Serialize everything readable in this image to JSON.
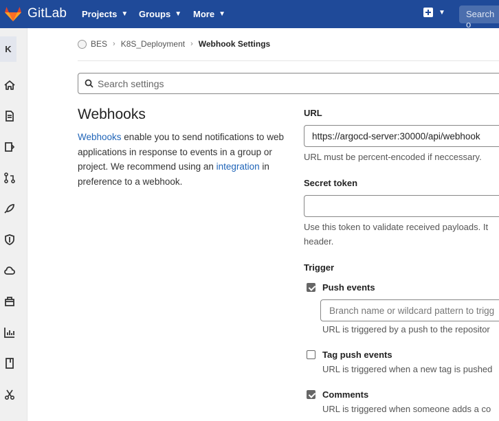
{
  "header": {
    "brand": "GitLab",
    "nav": [
      {
        "label": "Projects"
      },
      {
        "label": "Groups"
      },
      {
        "label": "More"
      }
    ],
    "search_placeholder": "Search o"
  },
  "sidebar": {
    "avatar_letter": "K",
    "icons": [
      "home-icon",
      "file-icon",
      "issues-icon",
      "merge-request-icon",
      "rocket-icon",
      "shield-icon",
      "cloud-icon",
      "package-icon",
      "analytics-icon",
      "book-icon",
      "scissors-icon"
    ]
  },
  "breadcrumb": {
    "items": [
      "BES",
      "K8S_Deployment",
      "Webhook Settings"
    ]
  },
  "settings_search": {
    "placeholder": "Search settings"
  },
  "intro": {
    "title": "Webhooks",
    "link1": "Webhooks",
    "text1": " enable you to send notifications to web applications in response to events in a group or project. We recommend using an ",
    "link2": "integration",
    "text2": " in preference to a webhook."
  },
  "form": {
    "url_label": "URL",
    "url_value": "https://argocd-server:30000/api/webhook",
    "url_help": "URL must be percent-encoded if neccessary.",
    "secret_label": "Secret token",
    "secret_value": "",
    "secret_help_line1": "Use this token to validate received payloads. It",
    "secret_help_line2": "header.",
    "trigger_label": "Trigger",
    "push_label": "Push events",
    "push_checked": true,
    "branch_placeholder": "Branch name or wildcard pattern to trigg",
    "push_help": "URL is triggered by a push to the repositor",
    "tag_label": "Tag push events",
    "tag_checked": false,
    "tag_help": "URL is triggered when a new tag is pushed",
    "comments_label": "Comments",
    "comments_checked": true,
    "comments_help": "URL is triggered when someone adds a co"
  },
  "colors": {
    "navbar": "#1f4a99",
    "link": "#1f64b8"
  }
}
